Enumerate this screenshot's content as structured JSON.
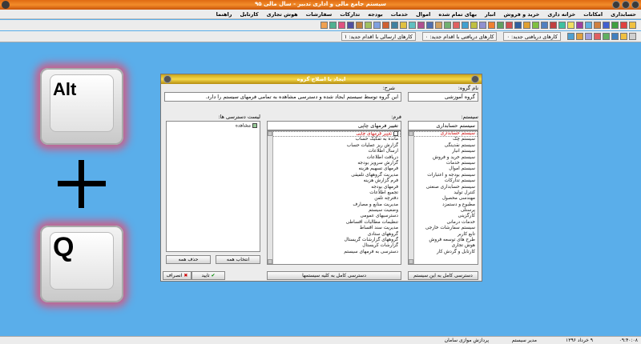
{
  "window": {
    "title": "سیستم جامع مالی و اداری تدبیر - سال مالی ۹۵"
  },
  "menu": [
    "حسابداری",
    "امکانات",
    "خزانه داری",
    "خرید و فروش",
    "انبار",
    "بهای تمام شده",
    "اموال",
    "خدمات",
    "بودجه",
    "تدارکات",
    "سفارشات",
    "هوش تجاری",
    "کارتابل",
    "راهنما"
  ],
  "tabs": [
    "کارهای دریافتی جدید: ۰",
    "کارهای دریافتی با اقدام جدید: ۰",
    "کارهای ارسالی با اقدام جدید: ۱"
  ],
  "keys": {
    "alt": "Alt",
    "q": "Q"
  },
  "dialog": {
    "title": "ایجاد یا اصلاح گروه",
    "name_label": "نام گروه:",
    "name_value": "گروه آموزشی",
    "desc_label": "شرح:",
    "desc_value": "این گروه توسط سیستم ایجاد شده و دسترسی مشاهده به تمامی فرمهای سیستم را دارد.",
    "system_label": "سیستم:",
    "system_value": "سیستم حسابداری",
    "form_label": "فرم:",
    "form_value": "تغییر فرمهای چاپی",
    "access_label": "لیست دسترسی ها:",
    "systems": [
      "سیستم حسابداری",
      "سیستم چک",
      "سیستم نقدینگی",
      "سیستم انبار",
      "سیستم خرید و فروش",
      "سیستم خدمات",
      "سیستم اموال",
      "سیستم بودجه و اعتبارات",
      "سیستم تدارکات",
      "سیستم حسابداری صنعتی",
      "کنترل تولید",
      "مهندسی محصول",
      "مطبوع و دستمزد",
      "پرسنلی",
      "کارگزینی",
      "خدمات درمانی",
      "سیستم سفارشات خارجی",
      "تابع کاربر",
      "طرح های توسعه فروش",
      "هوش تجاری",
      "کارتابل و گردش کار"
    ],
    "forms": [
      "تغییر فرمهای چاپی",
      "مانده به تفکیک حساب",
      "گزارش ریز عملیات حساب",
      "ارسال اطلاعات",
      "دریافت اطلاعات",
      "گزارش سرویز بودجه",
      "فرمهای تسهیم هزینه",
      "مدیریت گروههای تلفیقی",
      "فرم گزارش هزینه",
      "فرمهای بودجه",
      "تجمیع اطلاعات",
      "دفترچه تلفن",
      "مدیریت منابع و مصارف",
      "وضعیت سیستم",
      "دسترسیهای عمومی",
      "تنظیمات مطالبات اقساطی",
      "مدیریت سند اقساط",
      "گروههای ستادی",
      "گروههای گزارشات گریستال",
      "گزارشات کریستال",
      "دسترسی به فرمهای سیستم"
    ],
    "access_items": [
      "مشاهده"
    ],
    "btn_access_system": "دسترسی کامل به این سیستم",
    "btn_access_all": "دسترسی کامل به کلیه سیستمها",
    "btn_select_all": "انتخاب همه",
    "btn_delete_all": "حذف همه",
    "btn_ok": "تایید",
    "btn_cancel": "انصراف"
  },
  "status": {
    "time": "۰۹:۴۰:۰۸",
    "date": "۹ خرداد ۱۳۹۶",
    "user": "مدیر سیستم",
    "company": "پردازش موازی سامان"
  }
}
